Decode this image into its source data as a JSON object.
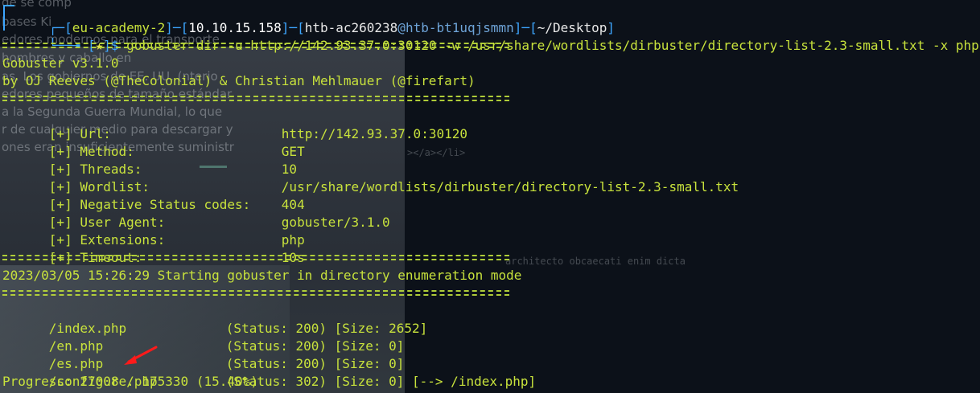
{
  "prompt": {
    "open1": "┌─[",
    "context": "eu-academy-2",
    "mid1": "]─[",
    "ip": "10.10.15.158",
    "mid2": "]─[",
    "user": "htb-ac260238",
    "at": "@",
    "host": "htb-bt1uqjsmmn",
    "mid3": "]─[",
    "cwd": "~/Desktop",
    "close1": "]",
    "open2": "└──╼ [",
    "star": "★",
    "close2": "]$ ",
    "command": "gobuster dir -u http://142.93.37.0:30120 -w /usr/share/wordlists/dirbuster/directory-list-2.3-small.txt -x php"
  },
  "banner": {
    "title": "Gobuster v3.1.0",
    "authors": "by OJ Reeves (@TheColonial) & Christian Mehlmauer (@firefart)"
  },
  "config": [
    {
      "key": "[+] Url:",
      "value": "http://142.93.37.0:30120"
    },
    {
      "key": "[+] Method:",
      "value": "GET"
    },
    {
      "key": "[+] Threads:",
      "value": "10"
    },
    {
      "key": "[+] Wordlist:",
      "value": "/usr/share/wordlists/dirbuster/directory-list-2.3-small.txt"
    },
    {
      "key": "[+] Negative Status codes:",
      "value": "404"
    },
    {
      "key": "[+] User Agent:",
      "value": "gobuster/3.1.0"
    },
    {
      "key": "[+] Extensions:",
      "value": "php"
    },
    {
      "key": "[+] Timeout:",
      "value": "10s"
    }
  ],
  "start_message": "2023/03/05 15:26:29 Starting gobuster in directory enumeration mode",
  "results": [
    {
      "path": "/index.php",
      "status": "(Status: 200)",
      "size": "[Size: 2652]",
      "redirect": ""
    },
    {
      "path": "/en.php",
      "status": "(Status: 200)",
      "size": "[Size: 0]",
      "redirect": ""
    },
    {
      "path": "/es.php",
      "status": "(Status: 200)",
      "size": "[Size: 0]",
      "redirect": ""
    },
    {
      "path": "/configure.php",
      "status": "(Status: 302)",
      "size": "[Size: 0]",
      "redirect": "[--> /index.php]"
    }
  ],
  "progress": "Progress: 27008 / 175330 (15.40%)",
  "background_page": {
    "text_lines": [
      "de se comp",
      "bases Ki",
      "edores modernos para el transporte",
      "hombres y caballo en",
      "as. Los gobiernos de EE. UU. (nterio",
      "edores pequeños de tamaño estándar",
      "a la Segunda Guerra Mundial, lo que",
      "r de cualquier medio para descargar y",
      "ones eran insuficientemente suministr"
    ],
    "code_snippet": "></a></li>",
    "lorem": "architecto obcaecati enim dicta",
    "colors": {
      "accent": "#78c8aa"
    }
  },
  "colors": {
    "background": "#0c1119",
    "prompt_frame": "#3da6ff",
    "text": "#c8e23c",
    "path": "#e6e64a"
  }
}
